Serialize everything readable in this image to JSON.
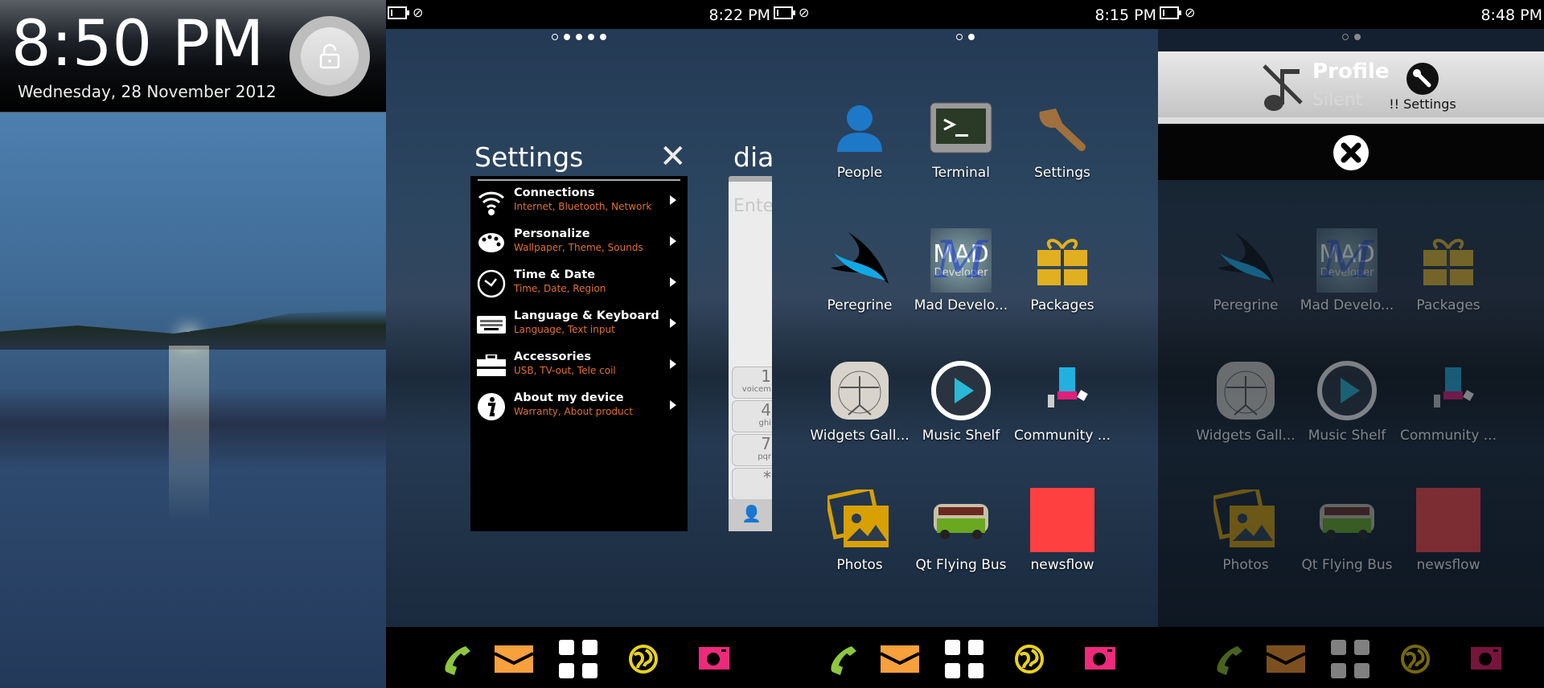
{
  "lockscreen": {
    "time": "8:50 PM",
    "date": "Wednesday, 28 November 2012",
    "icon": "lock-icon"
  },
  "settings_screen": {
    "status_time": "8:22 PM",
    "page_count": 5,
    "current_page": 1,
    "title": "Settings",
    "items": [
      {
        "title": "Connections",
        "subtitle": "Internet, Bluetooth, Network",
        "icon": "wifi-icon"
      },
      {
        "title": "Personalize",
        "subtitle": "Wallpaper, Theme, Sounds",
        "icon": "palette-icon"
      },
      {
        "title": "Time & Date",
        "subtitle": "Time, Date, Region",
        "icon": "clock-icon"
      },
      {
        "title": "Language & Keyboard",
        "subtitle": "Language, Text input",
        "icon": "keyboard-icon"
      },
      {
        "title": "Accessories",
        "subtitle": "USB, TV-out, Tele coil",
        "icon": "toolbox-icon"
      },
      {
        "title": "About my device",
        "subtitle": "Warranty, About product",
        "icon": "info-icon"
      }
    ],
    "dialer": {
      "title": "dial",
      "placeholder": "Ente",
      "keys": [
        {
          "d": "1",
          "s": "voicem"
        },
        {
          "d": "4",
          "s": "ghi"
        },
        {
          "d": "7",
          "s": "pqr"
        },
        {
          "d": "*",
          "s": ""
        }
      ]
    }
  },
  "home_screen": {
    "status_time": "8:15 PM",
    "page_count": 2,
    "current_page": 1,
    "apps": [
      {
        "label": "People",
        "icon": "person-icon"
      },
      {
        "label": "Terminal",
        "icon": "terminal-icon"
      },
      {
        "label": "Settings",
        "icon": "wrench-icon"
      },
      {
        "label": "Peregrine",
        "icon": "peregrine-icon"
      },
      {
        "label": "Mad Develo...",
        "icon": "mad-developer-icon",
        "logo_text": "MAD Developer"
      },
      {
        "label": "Packages",
        "icon": "gift-icon"
      },
      {
        "label": "Widgets Gall...",
        "icon": "vitruvian-icon"
      },
      {
        "label": "Music Shelf",
        "icon": "play-icon"
      },
      {
        "label": "Community ...",
        "icon": "community-icon"
      },
      {
        "label": "Photos",
        "icon": "photos-icon"
      },
      {
        "label": "Qt Flying Bus",
        "icon": "bus-icon"
      },
      {
        "label": "newsflow",
        "icon": "newsflow-icon"
      }
    ]
  },
  "profile_screen": {
    "status_time": "8:48 PM",
    "page_count": 2,
    "current_page": 1,
    "profile_label": "Profile",
    "profile_value": "Silent",
    "settings_label": "!! Settings"
  },
  "dock": [
    {
      "icon": "phone-icon",
      "color": "#8dc63f"
    },
    {
      "icon": "mail-icon",
      "color": "#f7a03c"
    },
    {
      "icon": "app-grid-icon",
      "color": "#ffffff"
    },
    {
      "icon": "browser-globe-icon",
      "color": "#e8d21e"
    },
    {
      "icon": "camera-icon",
      "color": "#ee2a7b"
    }
  ]
}
